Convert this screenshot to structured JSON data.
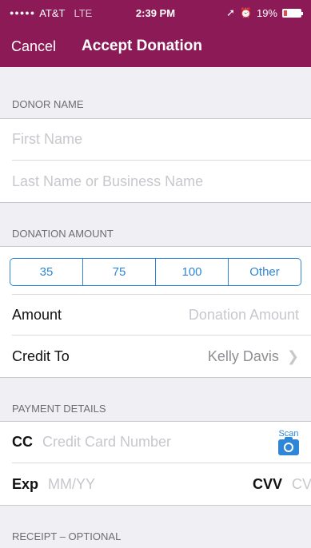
{
  "status_bar": {
    "signal": "●●●●●",
    "carrier": "AT&T",
    "network": "LTE",
    "time": "2:39 PM",
    "location_icon": "location-arrow-icon",
    "alarm_icon": "alarm-clock-icon",
    "battery_percent": "19%",
    "battery_level": 0.19,
    "battery_color": "#e8484e"
  },
  "nav": {
    "cancel_label": "Cancel",
    "title": "Accept Donation",
    "bar_color": "#8b1a56"
  },
  "donor": {
    "header": "DONOR NAME",
    "first_name_placeholder": "First Name",
    "last_name_placeholder": "Last Name or Business Name"
  },
  "donation": {
    "header": "DONATION AMOUNT",
    "segments": [
      "35",
      "75",
      "100",
      "Other"
    ],
    "amount_label": "Amount",
    "amount_placeholder": "Donation Amount",
    "credit_to_label": "Credit To",
    "credit_to_value": "Kelly Davis",
    "accent_color": "#2f86d6"
  },
  "payment": {
    "header": "PAYMENT DETAILS",
    "cc_label": "CC",
    "cc_placeholder": "Credit Card Number",
    "scan_label": "Scan",
    "scan_icon": "camera-icon",
    "exp_label": "Exp",
    "exp_placeholder": "MM/YY",
    "cvv_label": "CVV",
    "cvv_placeholder": "CVV"
  },
  "receipt": {
    "header": "RECEIPT – OPTIONAL"
  }
}
